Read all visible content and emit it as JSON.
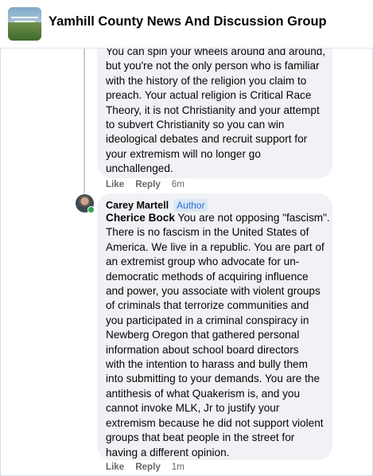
{
  "header": {
    "group_name": "Yamhill County News And Discussion Group"
  },
  "comments": [
    {
      "lines": [
        "You can spin your wheels around and around,",
        "but you're not the only person who is familiar",
        "with the history of the religion you claim to",
        "preach. Your actual religion is Critical Race",
        "Theory, it is not Christianity and your attempt",
        "to subvert Christianity so you can win",
        "ideological debates and recruit support for",
        "your extremism will no longer go",
        "unchallenged."
      ],
      "like_label": "Like",
      "reply_label": "Reply",
      "timestamp": "6m"
    },
    {
      "author": "Carey Martell",
      "badge": "Author",
      "mention": "Cherice Bock",
      "first_line_rest": " You are not opposing \"fascism\".",
      "lines": [
        "There is no fascism in the United States of",
        "America. We live in a republic. You are part of",
        "an extremist group who advocate for un-",
        "democratic methods of acquiring influence",
        "and power, you associate with violent groups",
        "of criminals that terrorize communities and",
        "you participated in a criminal conspiracy in",
        "Newberg Oregon that gathered personal",
        "information about school board directors",
        "with the intention to harass and bully them",
        "into submitting to your demands. You are the",
        "antithesis of what Quakerism is, and you",
        "cannot invoke MLK, Jr to justify your",
        "extremism because he did not support violent",
        "groups that beat people in the street for",
        "having a different opinion."
      ],
      "like_label": "Like",
      "reply_label": "Reply",
      "timestamp": "1m"
    }
  ],
  "colors": {
    "bubble": "#f0f2f5",
    "meta_text": "#65676b",
    "badge_text": "#216fdb",
    "badge_bg": "#dbe7f2",
    "online": "#31a24c"
  }
}
